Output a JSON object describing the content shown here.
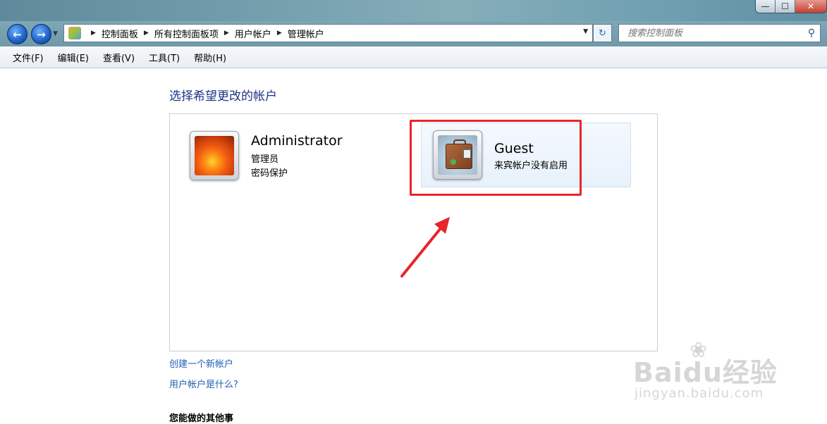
{
  "window": {
    "minimize_glyph": "—",
    "maximize_glyph": "☐",
    "close_glyph": "✕"
  },
  "addressbar": {
    "breadcrumbs": [
      "控制面板",
      "所有控制面板项",
      "用户帐户",
      "管理帐户"
    ],
    "search_placeholder": "搜索控制面板"
  },
  "menubar": {
    "items": [
      "文件(F)",
      "编辑(E)",
      "查看(V)",
      "工具(T)",
      "帮助(H)"
    ]
  },
  "main": {
    "heading": "选择希望更改的帐户",
    "accounts": [
      {
        "name": "Administrator",
        "role": "管理员",
        "status": "密码保护",
        "icon": "flower-avatar-icon"
      },
      {
        "name": "Guest",
        "status": "来宾帐户没有启用",
        "icon": "suitcase-avatar-icon"
      }
    ],
    "links": [
      "创建一个新帐户",
      "用户帐户是什么?"
    ],
    "other_tasks_heading": "您能做的其他事"
  },
  "watermark": {
    "brand": "Baidu经验",
    "url": "jingyan.baidu.com"
  },
  "colors": {
    "heading": "#1e3287",
    "link": "#1f5fb0",
    "highlight": "#e8252c"
  }
}
